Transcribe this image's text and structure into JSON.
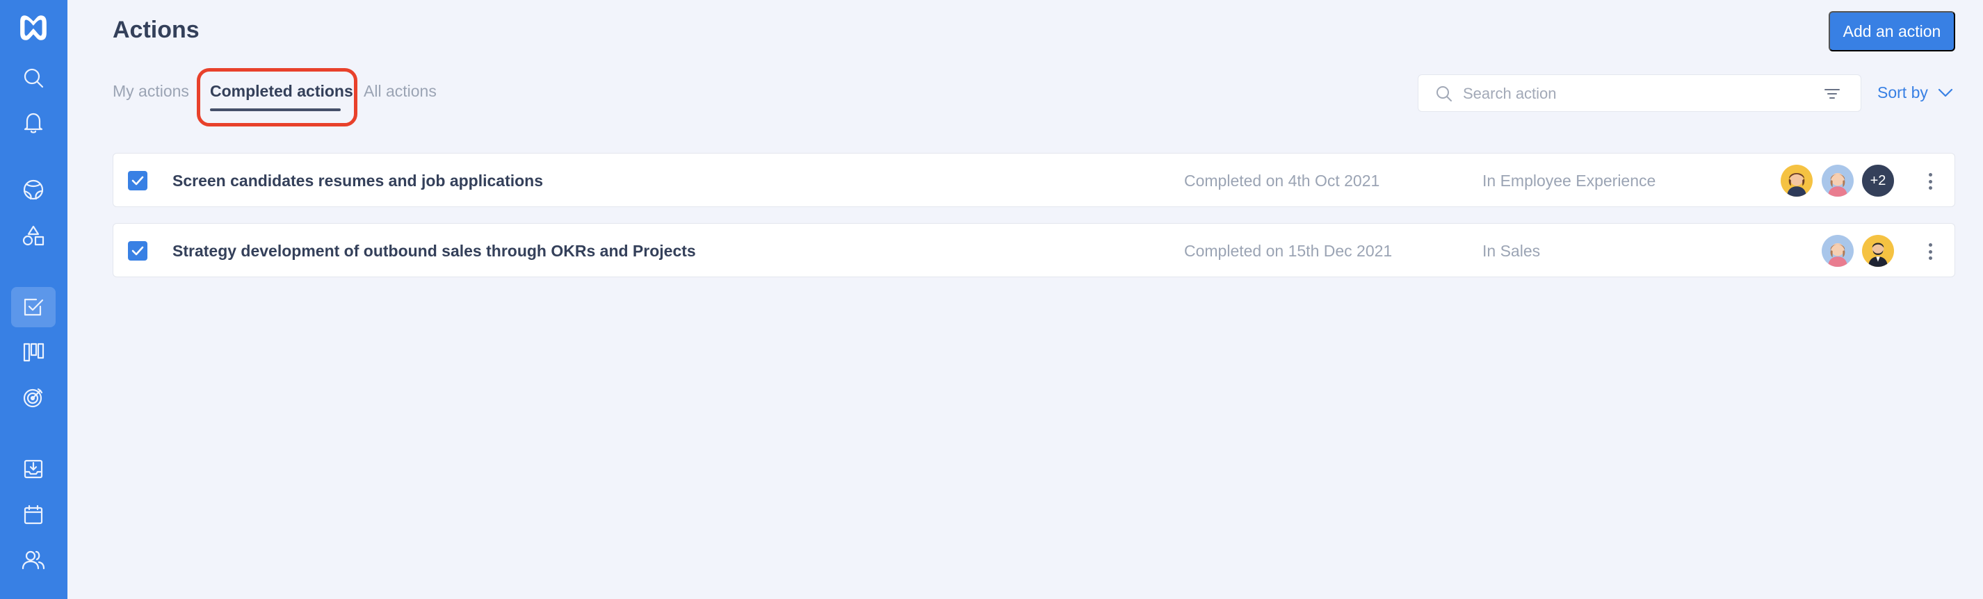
{
  "page": {
    "title": "Actions",
    "add_button": "Add an action"
  },
  "tabs": [
    {
      "label": "My actions",
      "active": false
    },
    {
      "label": "Completed actions",
      "active": true
    },
    {
      "label": "All actions",
      "active": false
    }
  ],
  "search": {
    "placeholder": "Search action",
    "value": ""
  },
  "sort": {
    "label": "Sort by"
  },
  "sidebar": {
    "items": [
      {
        "icon": "logo-icon"
      },
      {
        "icon": "search-icon"
      },
      {
        "icon": "bell-icon"
      },
      {
        "icon": "globe-icon"
      },
      {
        "icon": "shapes-icon"
      },
      {
        "icon": "check-square-icon",
        "active": true
      },
      {
        "icon": "kanban-icon"
      },
      {
        "icon": "target-icon"
      },
      {
        "icon": "inbox-download-icon"
      },
      {
        "icon": "calendar-icon"
      },
      {
        "icon": "users-icon"
      }
    ]
  },
  "actions": [
    {
      "title": "Screen candidates resumes and job applications",
      "completed": "Completed on 4th Oct 2021",
      "team": "In Employee Experience",
      "checked": true,
      "assignees": [
        "avatar-woman-dark-hair",
        "avatar-woman-brown-hair"
      ],
      "more_count": "+2"
    },
    {
      "title": "Strategy development of outbound sales through OKRs and Projects",
      "completed": "Completed on 15th Dec 2021",
      "team": "In Sales",
      "checked": true,
      "assignees": [
        "avatar-woman-brown-hair",
        "avatar-man-beard"
      ]
    }
  ],
  "colors": {
    "accent": "#3880e4",
    "highlight": "#e8412b",
    "text": "#34405a",
    "muted": "#9ba4b4"
  }
}
